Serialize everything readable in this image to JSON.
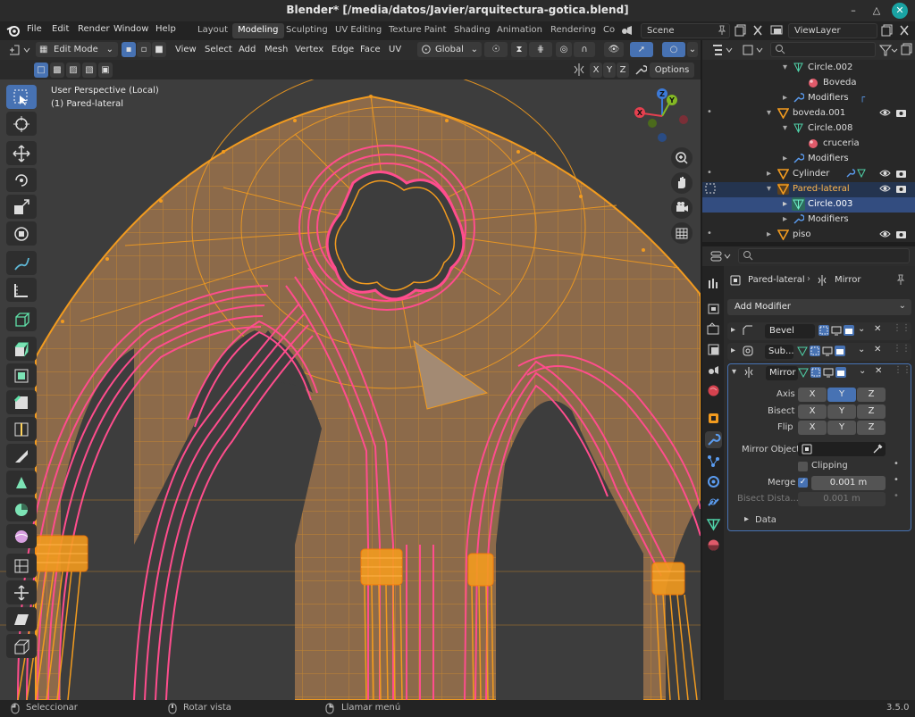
{
  "window": {
    "title": "Blender* [/media/datos/Javier/arquitectura-gotica.blend]"
  },
  "menu": {
    "items": [
      "File",
      "Edit",
      "Render",
      "Window",
      "Help"
    ]
  },
  "workspaces": {
    "tabs": [
      "Layout",
      "Modeling",
      "Sculpting",
      "UV Editing",
      "Texture Paint",
      "Shading",
      "Animation",
      "Rendering",
      "Co"
    ],
    "active": "Modeling"
  },
  "scene": {
    "name": "Scene",
    "view_layer": "ViewLayer"
  },
  "viewport_header": {
    "mode": "Edit Mode",
    "menus": [
      "View",
      "Select",
      "Add",
      "Mesh",
      "Vertex",
      "Edge",
      "Face",
      "UV"
    ],
    "orientation": "Global",
    "axes": [
      "X",
      "Y",
      "Z"
    ],
    "options_label": "Options"
  },
  "viewport": {
    "perspective": "User Perspective (Local)",
    "object": "(1) Pared-lateral",
    "gizmo": {
      "x": "X",
      "y": "Y",
      "z": "Z"
    }
  },
  "outliner": {
    "rows": [
      {
        "name": "Circle.002",
        "kind": "mesh-data"
      },
      {
        "name": "Boveda",
        "kind": "material"
      },
      {
        "name": "Modifiers",
        "kind": "modifiers"
      },
      {
        "name": "boveda.001",
        "kind": "object"
      },
      {
        "name": "Circle.008",
        "kind": "mesh-data"
      },
      {
        "name": "cruceria",
        "kind": "material"
      },
      {
        "name": "Modifiers",
        "kind": "modifiers"
      },
      {
        "name": "Cylinder",
        "kind": "object"
      },
      {
        "name": "Pared-lateral",
        "kind": "object"
      },
      {
        "name": "Circle.003",
        "kind": "mesh-data"
      },
      {
        "name": "Modifiers",
        "kind": "modifiers"
      },
      {
        "name": "piso",
        "kind": "object"
      }
    ]
  },
  "properties": {
    "breadcrumb_object": "Pared-lateral",
    "breadcrumb_modifier": "Mirror",
    "add_modifier_label": "Add Modifier",
    "modifiers": [
      {
        "name": "Bevel",
        "expanded": false
      },
      {
        "name": "Sub...",
        "expanded": false
      },
      {
        "name": "Mirror",
        "expanded": true
      }
    ],
    "mirror": {
      "axis_label": "Axis",
      "bisect_label": "Bisect",
      "flip_label": "Flip",
      "axes": [
        "X",
        "Y",
        "Z"
      ],
      "axis_active": "Y",
      "mirror_object_label": "Mirror Object",
      "clipping_label": "Clipping",
      "clipping": false,
      "merge_label": "Merge",
      "merge": true,
      "merge_value": "0.001 m",
      "bisect_distance_label": "Bisect Dista...",
      "bisect_distance_value": "0.001 m",
      "data_label": "Data"
    }
  },
  "statusbar": {
    "left": "Seleccionar",
    "middle": "Rotar vista",
    "right": "Llamar menú",
    "version": "3.5.0"
  },
  "colors": {
    "accent": "#4772b3",
    "wire_orange": "#f29b1f",
    "wire_pink": "#ff4d8d",
    "face_fill": "#8c6a4a",
    "viewport_bg": "#3d3d3d"
  }
}
